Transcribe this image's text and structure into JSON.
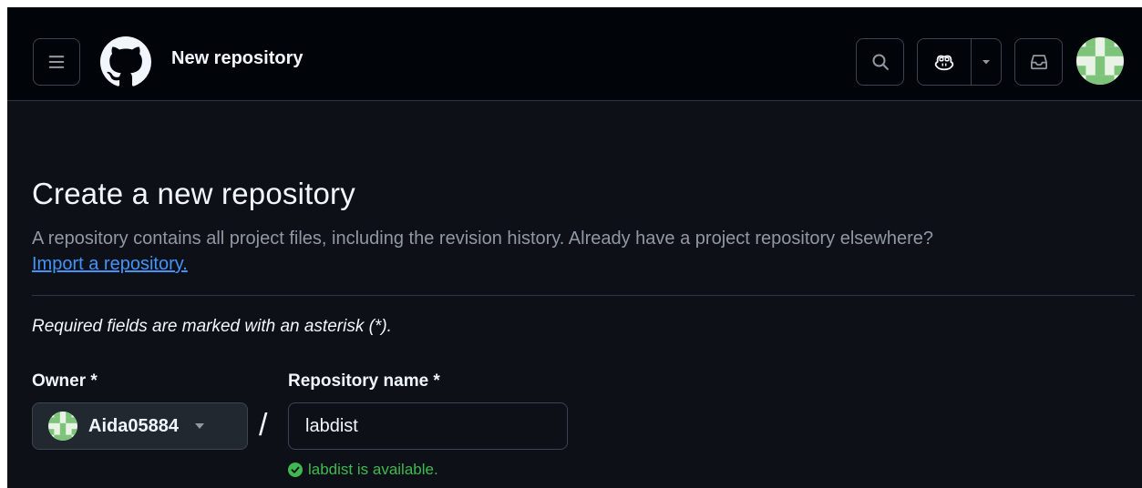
{
  "header": {
    "title": "New repository",
    "icons": [
      "hamburger-menu-icon",
      "github-logo-icon",
      "search-icon",
      "copilot-icon",
      "triangle-down-icon",
      "inbox-icon",
      "avatar"
    ]
  },
  "main": {
    "heading": "Create a new repository",
    "description": "A repository contains all project files, including the revision history. Already have a project repository elsewhere?",
    "import_link": "Import a repository.",
    "required_note": "Required fields are marked with an asterisk (*).",
    "owner": {
      "label": "Owner *",
      "value": "Aida05884"
    },
    "separator": "/",
    "repo_name": {
      "label": "Repository name *",
      "value": "labdist"
    },
    "availability": "labdist is available."
  },
  "colors": {
    "background": "#0d1117",
    "header_bg": "#010409",
    "link": "#4493f8",
    "success": "#3fb950",
    "muted_text": "#9198a1"
  }
}
